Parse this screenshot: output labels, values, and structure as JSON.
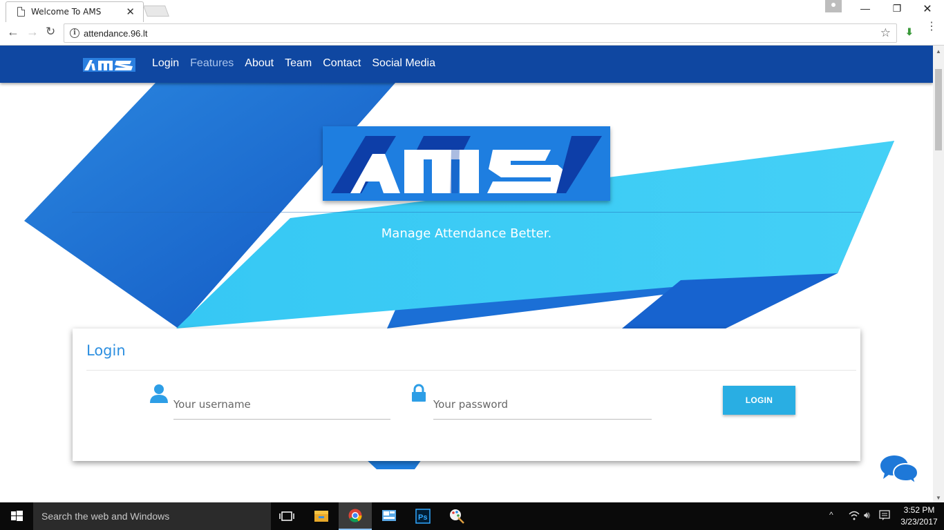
{
  "browser": {
    "tab_title": "Welcome To AMS",
    "tab_close": "✕",
    "url": "attendance.96.lt",
    "minimize": "—",
    "maximize": "❐",
    "close": "✕",
    "back": "←",
    "forward": "→",
    "reload": "↻",
    "star": "☆",
    "menu": "⋮",
    "info": "i",
    "extension": "⬇"
  },
  "navbar": {
    "logo_text": "AMS",
    "links": [
      "Login",
      "Features",
      "About",
      "Team",
      "Contact",
      "Social Media"
    ],
    "active_link": "Features"
  },
  "hero": {
    "logo_text": "AMS",
    "tagline": "Manage Attendance Better."
  },
  "login": {
    "title": "Login",
    "username_placeholder": "Your username",
    "password_placeholder": "Your password",
    "button_label": "LOGIN"
  },
  "taskbar": {
    "search_placeholder": "Search the web and Windows",
    "time": "3:52 PM",
    "date": "3/23/2017"
  },
  "colors": {
    "navbar": "#0f47a1",
    "accent_blue": "#2d8fe0",
    "login_button": "#29aee3",
    "hero_cyan": "#3ecdf5",
    "hero_blue": "#1e7ee0"
  },
  "icons": [
    "page-icon",
    "info-icon",
    "star-icon",
    "user-icon",
    "lock-icon",
    "chat-icon",
    "windows-start-icon",
    "task-view-icon",
    "file-explorer-icon",
    "chrome-icon",
    "photoshop-icon",
    "paint-icon",
    "wifi-icon",
    "volume-icon",
    "action-center-icon"
  ]
}
